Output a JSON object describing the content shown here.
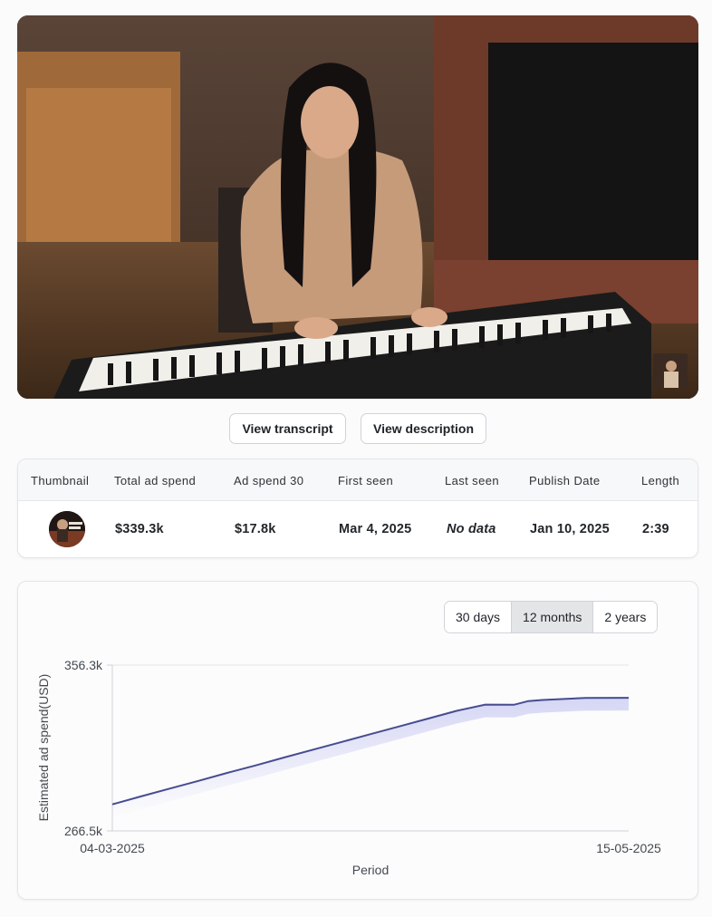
{
  "buttons": {
    "transcript": "View transcript",
    "description": "View description"
  },
  "table": {
    "headers": [
      "Thumbnail",
      "Total ad spend",
      "Ad spend 30",
      "First seen",
      "Last seen",
      "Publish Date",
      "Length"
    ],
    "row": {
      "total_ad_spend": "$339.3k",
      "ad_spend_30": "$17.8k",
      "first_seen": "Mar 4, 2025",
      "last_seen": "No data",
      "publish_date": "Jan 10, 2025",
      "length": "2:39"
    }
  },
  "range": {
    "options": [
      "30 days",
      "12 months",
      "2 years"
    ],
    "selected": "12 months"
  },
  "colors": {
    "line": "#474c8f",
    "accent_fill": "#7b7fe0"
  },
  "chart_data": {
    "type": "line",
    "title": "",
    "xlabel": "Period",
    "ylabel": "Estimated ad spend(USD)",
    "x_ticks": [
      "04-03-2025",
      "15-05-2025"
    ],
    "y_ticks": [
      "356.3k",
      "266.5k"
    ],
    "ylim": [
      266.5,
      356.3
    ],
    "x": [
      "04-03-2025",
      "08-03-2025",
      "12-03-2025",
      "16-03-2025",
      "20-03-2025",
      "24-03-2025",
      "28-03-2025",
      "01-04-2025",
      "05-04-2025",
      "09-04-2025",
      "13-04-2025",
      "17-04-2025",
      "21-04-2025",
      "25-04-2025",
      "29-04-2025",
      "01-05-2025",
      "03-05-2025",
      "05-05-2025",
      "09-05-2025",
      "15-05-2025"
    ],
    "series": [
      {
        "values": [
          280.9,
          285.2,
          289.4,
          293.6,
          297.9,
          302.0,
          306.3,
          310.5,
          314.7,
          318.9,
          323.1,
          327.3,
          331.5,
          334.9,
          334.8,
          336.8,
          337.4,
          337.8,
          338.5,
          338.6
        ]
      }
    ]
  }
}
